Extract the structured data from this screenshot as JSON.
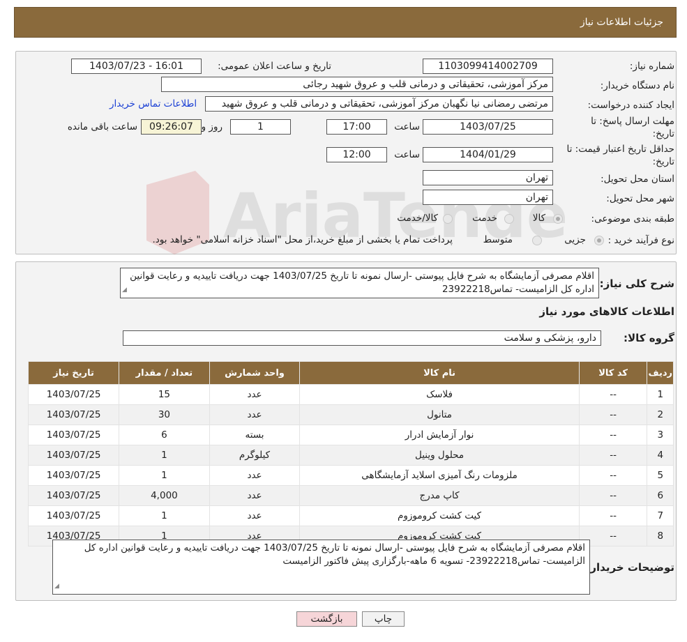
{
  "header": {
    "title": "جزئیات اطلاعات نیاز"
  },
  "form": {
    "need_number_label": "شماره نیاز:",
    "need_number": "1103099414002709",
    "announce_label": "تاریخ و ساعت اعلان عمومی:",
    "announce_value": "1403/07/23 - 16:01",
    "buyer_org_label": "نام دستگاه خریدار:",
    "buyer_org": "مرکز آموزشی، تحقیقاتی و درمانی قلب و عروق شهید رجائی",
    "creator_label": "ایجاد کننده درخواست:",
    "creator": "مرتضی رمضانی نیا نگهبان مرکز آموزشی، تحقیقاتی و درمانی قلب و عروق شهید",
    "contact_link": "اطلاعات تماس خریدار",
    "deadline_label_1": "مهلت ارسال پاسخ: تا",
    "deadline_label_2": "تاریخ:",
    "deadline_date": "1403/07/25",
    "time_label": "ساعت",
    "deadline_time": "17:00",
    "days": "1",
    "days_label": "روز و",
    "remaining_time": "09:26:07",
    "remaining_label": "ساعت باقی مانده",
    "validity_label_1": "حداقل تاریخ اعتبار قیمت: تا",
    "validity_label_2": "تاریخ:",
    "validity_date": "1404/01/29",
    "validity_time": "12:00",
    "province_label": "استان محل تحویل:",
    "province": "تهران",
    "city_label": "شهر محل تحویل:",
    "city": "تهران",
    "category_label": "طبقه بندی موضوعی:",
    "category_options": [
      "کالا",
      "خدمت",
      "کالا/خدمت"
    ],
    "process_label": "نوع فرآیند خرید :",
    "process_options": [
      "جزیی",
      "متوسط"
    ],
    "process_note": "پرداخت تمام یا بخشی از مبلغ خرید،از محل \"اسناد خزانه اسلامی\" خواهد بود."
  },
  "summary": {
    "label": "شرح کلی نیاز:",
    "text": "اقلام مصرفی آزمایشگاه به شرح فایل پیوستی -ارسال نمونه تا تاریخ 1403/07/25 جهت دریافت تاییدیه و رعایت قوانین اداره کل الزامیست- تماس23922218",
    "goods_info_title": "اطلاعات کالاهای مورد نیاز",
    "group_label": "گروه کالا:",
    "group_value": "دارو، پزشکی و سلامت"
  },
  "table": {
    "headers": [
      "ردیف",
      "کد کالا",
      "نام کالا",
      "واحد شمارش",
      "تعداد / مقدار",
      "تاریخ نیاز"
    ],
    "rows": [
      [
        "1",
        "--",
        "فلاسک",
        "عدد",
        "15",
        "1403/07/25"
      ],
      [
        "2",
        "--",
        "متانول",
        "عدد",
        "30",
        "1403/07/25"
      ],
      [
        "3",
        "--",
        "نوار آزمایش ادرار",
        "بسته",
        "6",
        "1403/07/25"
      ],
      [
        "4",
        "--",
        "محلول وینیل",
        "کیلوگرم",
        "1",
        "1403/07/25"
      ],
      [
        "5",
        "--",
        "ملزومات رنگ آمیزی اسلاید آزمایشگاهی",
        "عدد",
        "1",
        "1403/07/25"
      ],
      [
        "6",
        "--",
        "کاپ مدرج",
        "عدد",
        "4,000",
        "1403/07/25"
      ],
      [
        "7",
        "--",
        "کیت کشت کروموزوم",
        "عدد",
        "1",
        "1403/07/25"
      ],
      [
        "8",
        "--",
        "کیت کشت کروموزوم",
        "عدد",
        "1",
        "1403/07/25"
      ]
    ]
  },
  "buyer_notes": {
    "label": "توضیحات خریدار:",
    "text": "اقلام مصرفی آزمایشگاه به شرح فایل پیوستی -ارسال نمونه تا تاریخ 1403/07/25 جهت دریافت تاییدیه و رعایت قوانین اداره کل الزامیست- تماس23922218- تسویه 6 ماهه-بارگزاری پیش فاکتور الزامیست"
  },
  "buttons": {
    "print": "چاپ",
    "back": "بازگشت"
  },
  "watermark": {
    "text": "AriaTender.neT"
  },
  "colors": {
    "header_bg": "#8a6a3c",
    "link": "#1a3fd4",
    "back_button": "#f6d5d8"
  }
}
